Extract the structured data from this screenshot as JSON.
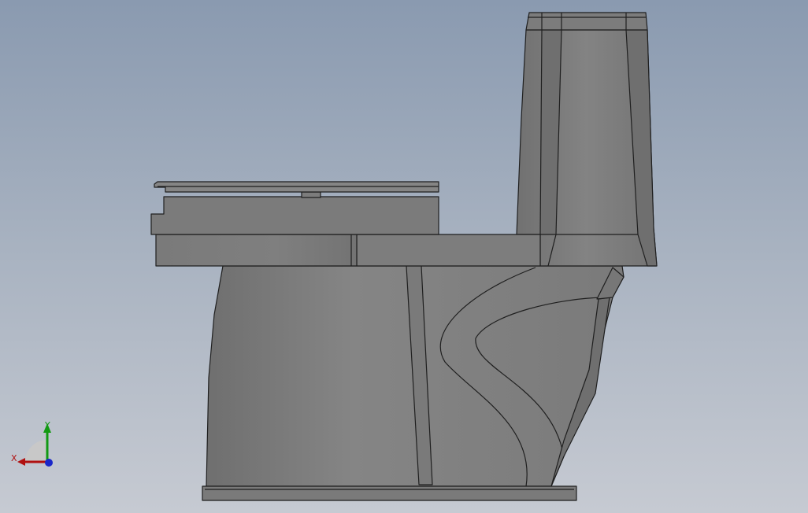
{
  "viewport": {
    "background_top": "#8a9ab0",
    "background_bottom": "#c6cad2"
  },
  "model": {
    "shade_color": "#7b7b7b",
    "edge_color": "#1f1f1f"
  },
  "triad": {
    "x_label": "X",
    "y_label": "Y",
    "x_color": "#b01010",
    "y_color": "#139a13",
    "z_color": "#1a27c9"
  }
}
